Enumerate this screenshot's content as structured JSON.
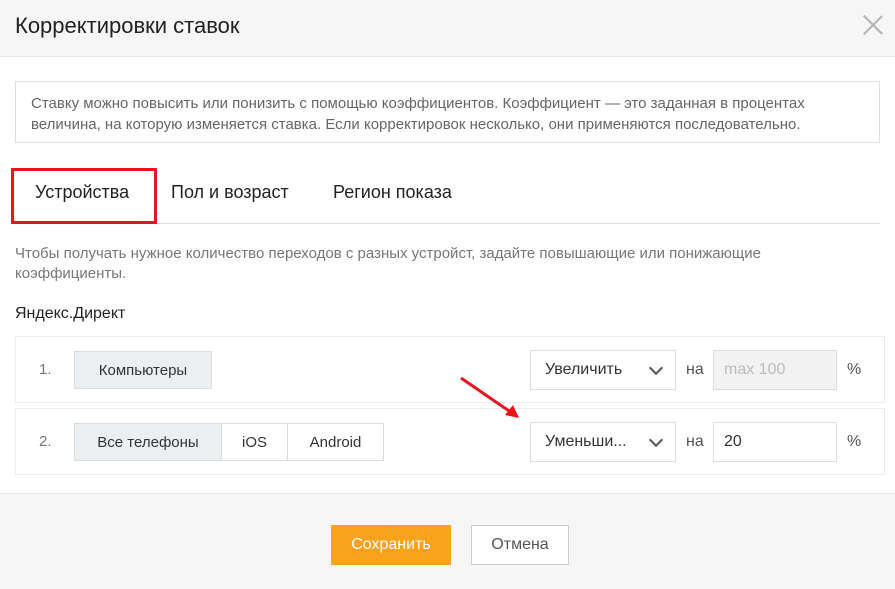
{
  "dialog": {
    "title": "Корректировки ставок"
  },
  "info_text": "Ставку можно повысить или понизить с помощью коэффициентов. Коэффициент — это заданная в процентах величина, на которую изменяется ставка. Если корректировок несколько, они применяются последовательно.",
  "tabs": [
    {
      "label": "Устройства",
      "active": true
    },
    {
      "label": "Пол и возраст",
      "active": false
    },
    {
      "label": "Регион показа",
      "active": false
    }
  ],
  "hint_text": "Чтобы получать нужное количество переходов с разных устройст, задайте повышающие или понижающие коэффициенты.",
  "section_title": "Яндекс.Директ",
  "rows": [
    {
      "number": "1.",
      "devices": [
        {
          "label": "Компьютеры"
        }
      ],
      "action": "Увеличить",
      "on_label": "на",
      "value": "",
      "placeholder": "max 100",
      "unit": "%"
    },
    {
      "number": "2.",
      "devices": [
        {
          "label": "Все телефоны"
        },
        {
          "label": "iOS"
        },
        {
          "label": "Android"
        }
      ],
      "action": "Уменьши...",
      "on_label": "на",
      "value": "20",
      "placeholder": "",
      "unit": "%"
    }
  ],
  "footer": {
    "save_label": "Сохранить",
    "cancel_label": "Отмена"
  },
  "colors": {
    "accent": "#f9a21a",
    "highlight": "#e8141e"
  }
}
